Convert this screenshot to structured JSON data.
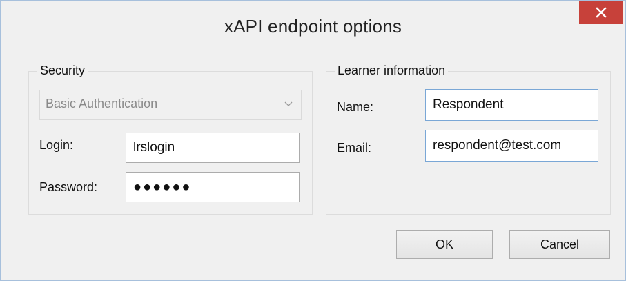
{
  "window": {
    "title": "xAPI endpoint options",
    "close_icon": "close-icon",
    "close_color": "#c7413a"
  },
  "security": {
    "legend": "Security",
    "auth_method": {
      "selected": "Basic Authentication",
      "icon": "chevron-down-icon"
    },
    "login_label": "Login:",
    "login_value": "lrslogin",
    "password_label": "Password:",
    "password_value": "●●●●●●"
  },
  "learner": {
    "legend": "Learner information",
    "name_label": "Name:",
    "name_value": "Respondent",
    "email_label": "Email:",
    "email_value": "respondent@test.com"
  },
  "buttons": {
    "ok": "OK",
    "cancel": "Cancel"
  }
}
